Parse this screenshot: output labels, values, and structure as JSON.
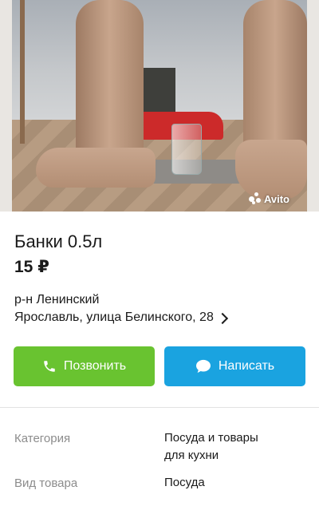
{
  "listing": {
    "title": "Банки 0.5л",
    "price": "15 ₽",
    "district": "р-н Ленинский",
    "address": "Ярославль, улица Белинского, 28"
  },
  "photo": {
    "watermark": "Avito"
  },
  "actions": {
    "call_label": "Позвонить",
    "write_label": "Написать",
    "call_color": "#69c330",
    "write_color": "#1aa3e0"
  },
  "params": [
    {
      "label": "Категория",
      "value_line1": "Посуда и товары",
      "value_line2": "для кухни"
    },
    {
      "label": "Вид товара",
      "value_line1": "Посуда"
    }
  ],
  "icons": {
    "call": "phone-icon",
    "write": "chat-bubble-icon",
    "address": "chevron-right-icon",
    "watermark": "avito-logo-icon"
  }
}
